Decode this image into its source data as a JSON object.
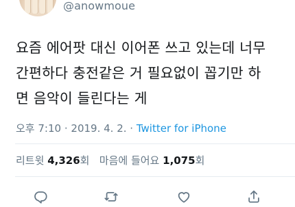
{
  "tweet": {
    "handle": "@anowmoue",
    "text": "요즘 에어팟 대신 이어폰 쓰고 있는데 너무\n간편하다 충전같은 거 필요없이 꼽기만 하\n면 음악이 들린다는 게",
    "time": "오후 7:10",
    "date": "2019. 4. 2.",
    "separator": "·",
    "source": "Twitter for iPhone"
  },
  "stats": {
    "retweets_label": "리트윗",
    "retweets_count": "4,326",
    "retweets_unit": "회",
    "likes_label": "마음에 들어요",
    "likes_count": "1,075",
    "likes_unit": "회"
  },
  "actions": {
    "icons": [
      "reply-icon",
      "retweet-icon",
      "like-icon",
      "share-icon"
    ]
  },
  "colors": {
    "text": "#14171a",
    "secondary": "#657786",
    "link": "#1b95e0",
    "divider": "#e6ecf0"
  }
}
